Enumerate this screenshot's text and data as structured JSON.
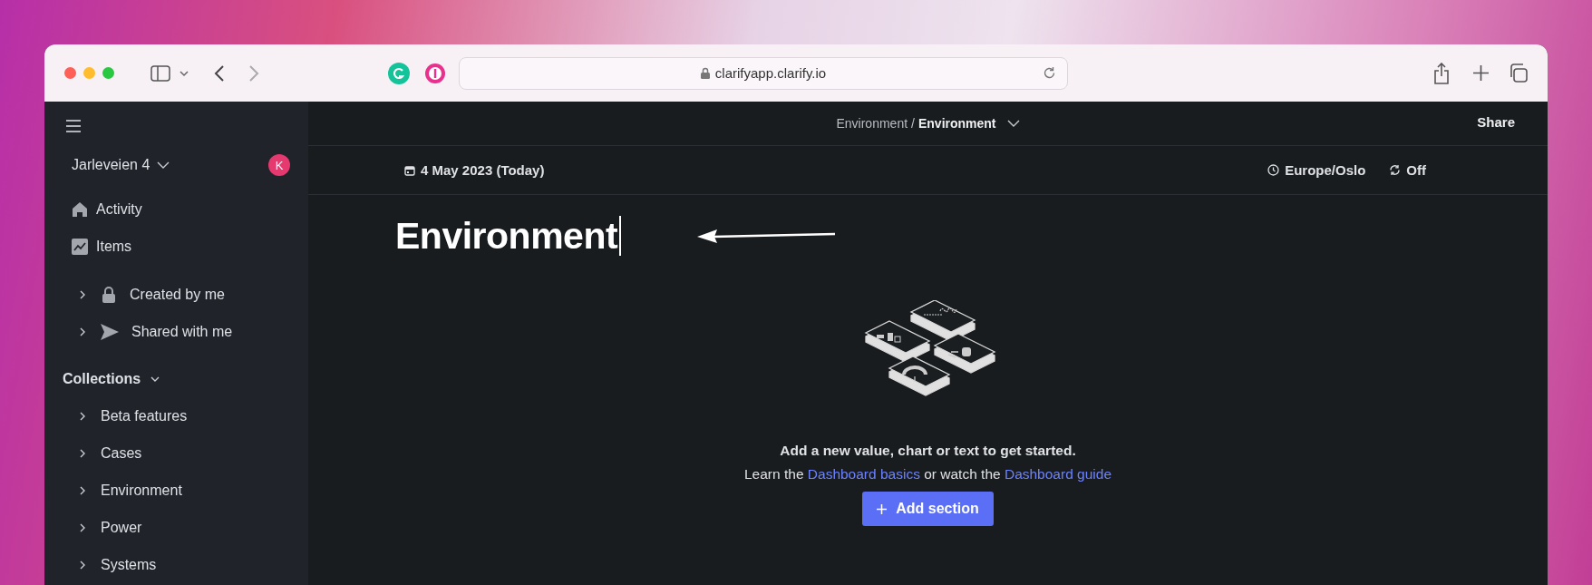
{
  "browser": {
    "url": "clarifyapp.clarify.io"
  },
  "sidebar": {
    "org": "Jarleveien 4",
    "avatar": "K",
    "nav": [
      {
        "label": "Activity"
      },
      {
        "label": "Items"
      }
    ],
    "groups": [
      {
        "label": "Created by me",
        "expanded": false
      },
      {
        "label": "Shared with me",
        "expanded": false
      }
    ],
    "collections": {
      "title": "Collections",
      "expanded": true,
      "items": [
        {
          "label": "Beta features",
          "expanded": false
        },
        {
          "label": "Cases",
          "expanded": false
        },
        {
          "label": "Environment",
          "expanded": false
        },
        {
          "label": "Power",
          "expanded": false
        },
        {
          "label": "Systems",
          "expanded": false
        }
      ]
    }
  },
  "header": {
    "breadcrumb_parent": "Environment",
    "breadcrumb_separator": "/",
    "breadcrumb_current": "Environment",
    "share": "Share"
  },
  "toolbar": {
    "date": "4 May 2023 (Today)",
    "timezone": "Europe/Oslo",
    "refresh": "Off"
  },
  "dashboard": {
    "title": "Environment",
    "empty_message": "Add a new value, chart or text to get started.",
    "help": [
      {
        "kind": "text",
        "text": "Learn the "
      },
      {
        "kind": "link",
        "text": "Dashboard basics"
      },
      {
        "kind": "text",
        "text": " or watch the "
      },
      {
        "kind": "link",
        "text": "Dashboard guide"
      }
    ],
    "add_button": "Add section"
  }
}
